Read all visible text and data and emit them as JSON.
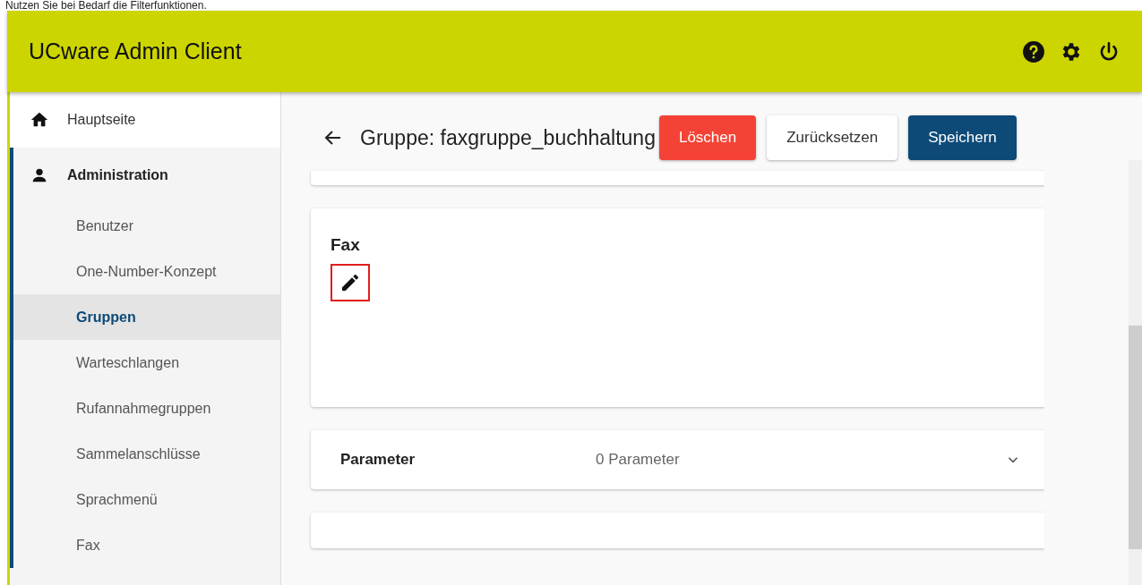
{
  "instruction": "Nutzen Sie bei Bedarf die Filterfunktionen.",
  "app_bar": {
    "title": "UCware Admin Client"
  },
  "sidebar": {
    "items": [
      {
        "label": "Hauptseite",
        "kind": "home",
        "expanded": false
      },
      {
        "label": "Administration",
        "kind": "person",
        "expanded": true,
        "children": [
          {
            "label": "Benutzer",
            "selected": false
          },
          {
            "label": "One-Number-Konzept",
            "selected": false
          },
          {
            "label": "Gruppen",
            "selected": true
          },
          {
            "label": "Warteschlangen",
            "selected": false
          },
          {
            "label": "Rufannahmegruppen",
            "selected": false
          },
          {
            "label": "Sammelanschlüsse",
            "selected": false
          },
          {
            "label": "Sprachmenü",
            "selected": false
          },
          {
            "label": "Fax",
            "selected": false
          }
        ]
      }
    ]
  },
  "page": {
    "title": "Gruppe: faxgruppe_buchhaltung",
    "buttons": [
      {
        "label": "Löschen",
        "kind": "danger"
      },
      {
        "label": "Zurücksetzen",
        "kind": "plain"
      },
      {
        "label": "Speichern",
        "kind": "primary"
      }
    ],
    "fax_card": {
      "title": "Fax",
      "edit_highlighted": true
    },
    "parameter_panel": {
      "title": "Parameter",
      "summary": "0 Parameter",
      "expanded": false
    }
  }
}
